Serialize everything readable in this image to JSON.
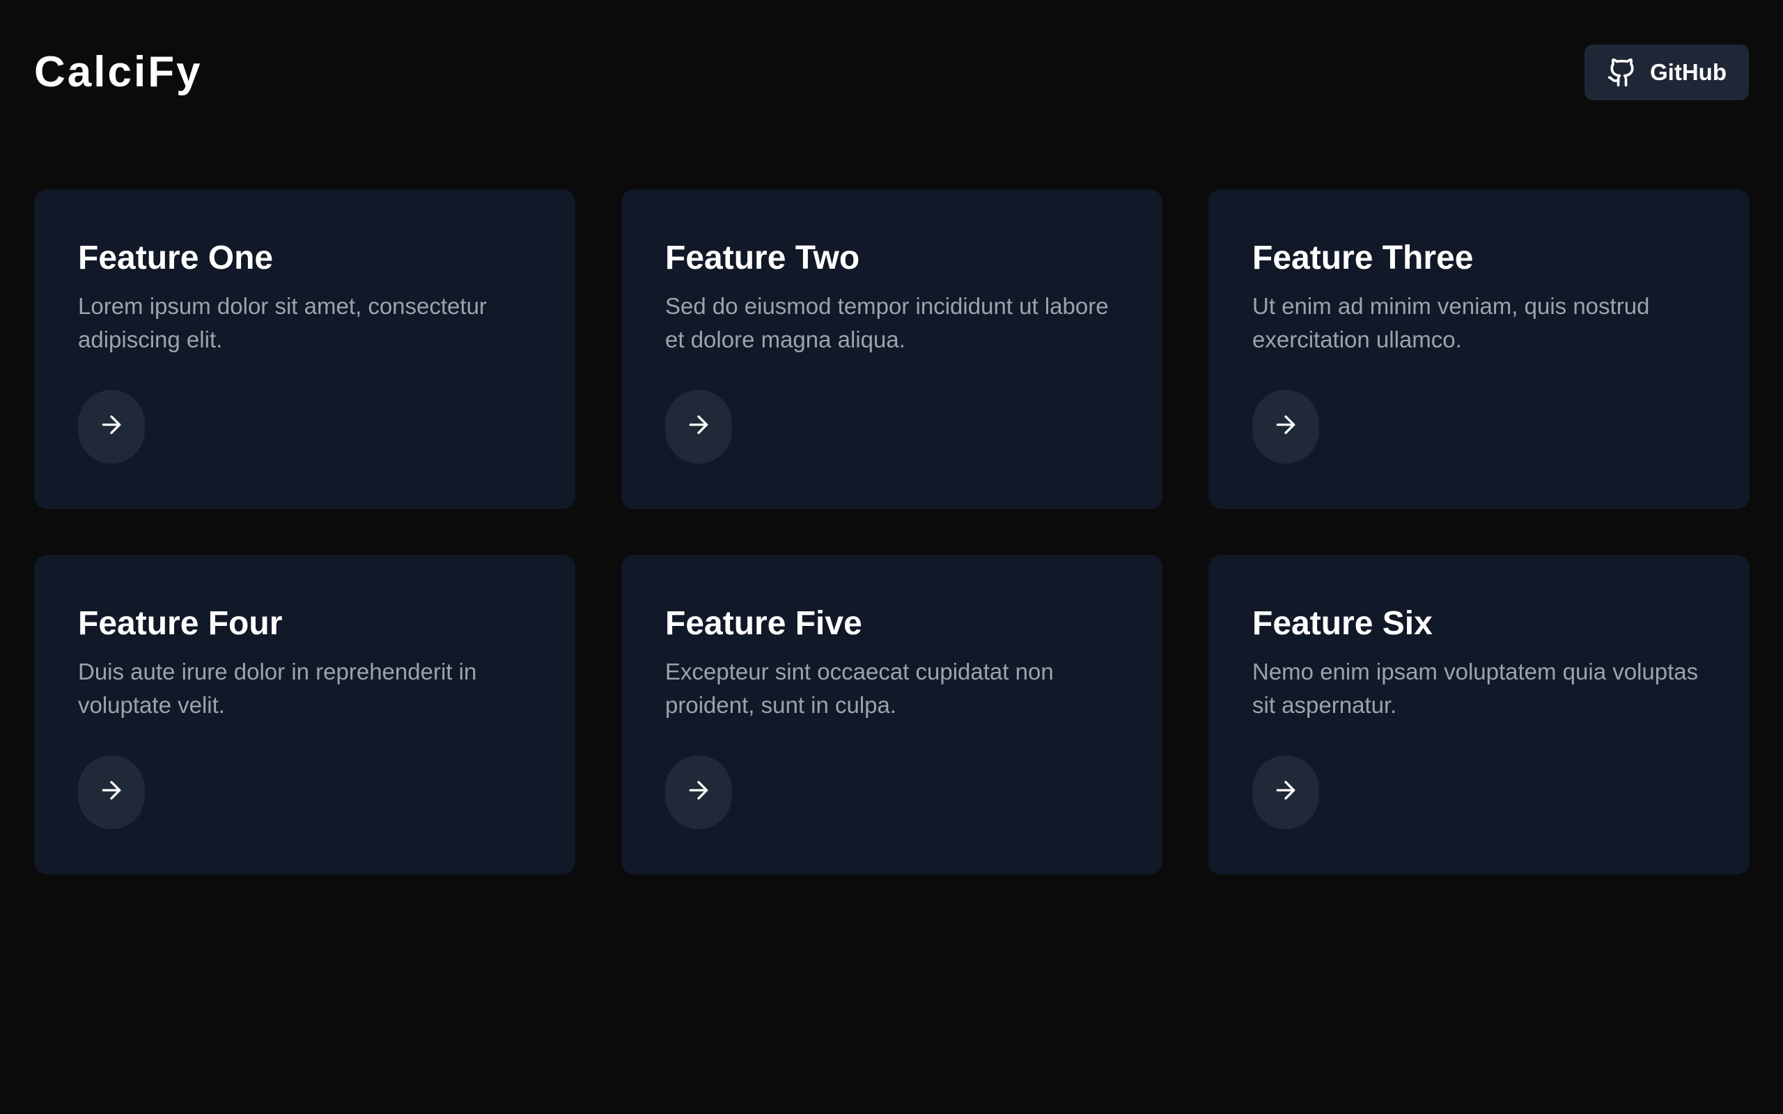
{
  "header": {
    "brand": "CalciFy",
    "github_label": "GitHub",
    "github_icon": "github-icon"
  },
  "features": [
    {
      "title": "Feature One",
      "description": "Lorem ipsum dolor sit amet, consectetur adipiscing elit.",
      "action_icon": "arrow-right-icon"
    },
    {
      "title": "Feature Two",
      "description": "Sed do eiusmod tempor incididunt ut labore et dolore magna aliqua.",
      "action_icon": "arrow-right-icon"
    },
    {
      "title": "Feature Three",
      "description": "Ut enim ad minim veniam, quis nostrud exercitation ullamco.",
      "action_icon": "arrow-right-icon"
    },
    {
      "title": "Feature Four",
      "description": "Duis aute irure dolor in reprehenderit in voluptate velit.",
      "action_icon": "arrow-right-icon"
    },
    {
      "title": "Feature Five",
      "description": "Excepteur sint occaecat cupidatat non proident, sunt in culpa.",
      "action_icon": "arrow-right-icon"
    },
    {
      "title": "Feature Six",
      "description": "Nemo enim ipsam voluptatem quia voluptas sit aspernatur.",
      "action_icon": "arrow-right-icon"
    }
  ],
  "colors": {
    "background": "#0b0b0b",
    "card": "#111827",
    "button": "#1e2736",
    "text": "#ffffff",
    "muted_text": "#9ca3af"
  }
}
